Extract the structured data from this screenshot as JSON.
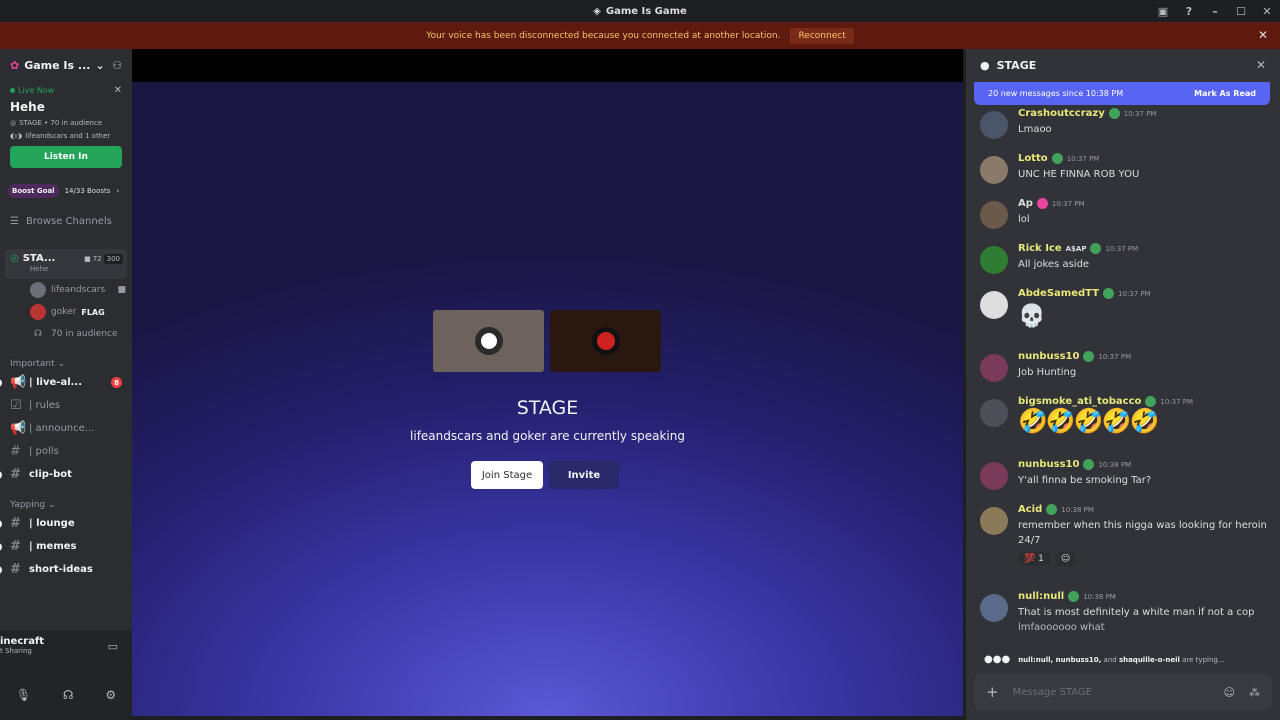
{
  "titlebar": {
    "title": "Game Is Game"
  },
  "banner": {
    "message": "Your voice has been disconnected because you connected at another location.",
    "reconnect": "Reconnect"
  },
  "server": {
    "name": "Game Is ..."
  },
  "live": {
    "label": "Live Now",
    "title": "Hehe",
    "meta": "STAGE • 70 in audience",
    "speakers": "lifeandscars and 1 other",
    "listen": "Listen In"
  },
  "boost": {
    "goal": "Boost Goal",
    "progress": "14/33 Boosts"
  },
  "browse": "Browse Channels",
  "stage_channel": {
    "name": "STA...",
    "sub": "Hehe",
    "count": "72",
    "cap": "300"
  },
  "members": [
    {
      "name": "lifeandscars"
    },
    {
      "name": "goker",
      "flag": "FLAG"
    },
    {
      "name": "70 in audience"
    }
  ],
  "categories": {
    "important": "Important",
    "yapping": "Yapping"
  },
  "channels_important": [
    {
      "name": "| live-al...",
      "unread": true,
      "badge": "8"
    },
    {
      "name": "| rules",
      "unread": false
    },
    {
      "name": "| announce...",
      "unread": false
    },
    {
      "name": "| polls",
      "unread": false
    },
    {
      "name": "clip-bot",
      "unread": true
    }
  ],
  "channels_yapping": [
    {
      "name": "| lounge",
      "unread": true
    },
    {
      "name": "| memes",
      "unread": true
    },
    {
      "name": "short-ideas",
      "unread": true
    }
  ],
  "voice": {
    "activity": "inecraft",
    "status": "t Sharing"
  },
  "stage": {
    "title": "STAGE",
    "subtitle": "lifeandscars and goker are currently speaking",
    "join": "Join Stage",
    "invite": "Invite"
  },
  "chat": {
    "title": "STAGE",
    "new_messages": "20 new messages since 10:38 PM",
    "mark_read": "Mark As Read",
    "placeholder": "Message STAGE",
    "typing_users": "null:null, nunbuss10,",
    "typing_and": "and",
    "typing_last": "shaquille-o-neil",
    "typing_suffix": "are typing..."
  },
  "messages": [
    {
      "user": "Crashoutccrazy",
      "color": "#e8e87a",
      "time": "10:37 PM",
      "text": "Lmaoo"
    },
    {
      "user": "Lotto",
      "color": "#e8e87a",
      "time": "10:37 PM",
      "text": "UNC HE FINNA ROB YOU"
    },
    {
      "user": "Ap",
      "color": "#dbdee1",
      "time": "10:37 PM",
      "text": "lol"
    },
    {
      "user": "Rick Ice",
      "color": "#e8e87a",
      "tag": "A$AP",
      "time": "10:37 PM",
      "text": "All jokes aside"
    },
    {
      "user": "AbdeSamedTT",
      "color": "#e8e87a",
      "time": "10:37 PM",
      "text": "💀"
    },
    {
      "user": "nunbuss10",
      "color": "#e8e87a",
      "time": "10:37 PM",
      "text": "Job Hunting"
    },
    {
      "user": "bigsmoke_ati_tobacco",
      "color": "#e8e87a",
      "time": "10:37 PM",
      "text": "🤣🤣🤣🤣🤣"
    },
    {
      "user": "nunbuss10",
      "color": "#e8e87a",
      "time": "10:38 PM",
      "text": "Y'all finna be smoking Tar?"
    },
    {
      "user": "Acid",
      "color": "#e8e87a",
      "time": "10:38 PM",
      "text": "remember when this nigga was looking for heroin 24/7",
      "reaction": "💯",
      "reaction_count": "1"
    },
    {
      "user": "null:null",
      "color": "#e8e87a",
      "time": "10:38 PM",
      "text": "That is most definitely a white man if not a cop",
      "text2": "lmfaoooooo what"
    }
  ]
}
